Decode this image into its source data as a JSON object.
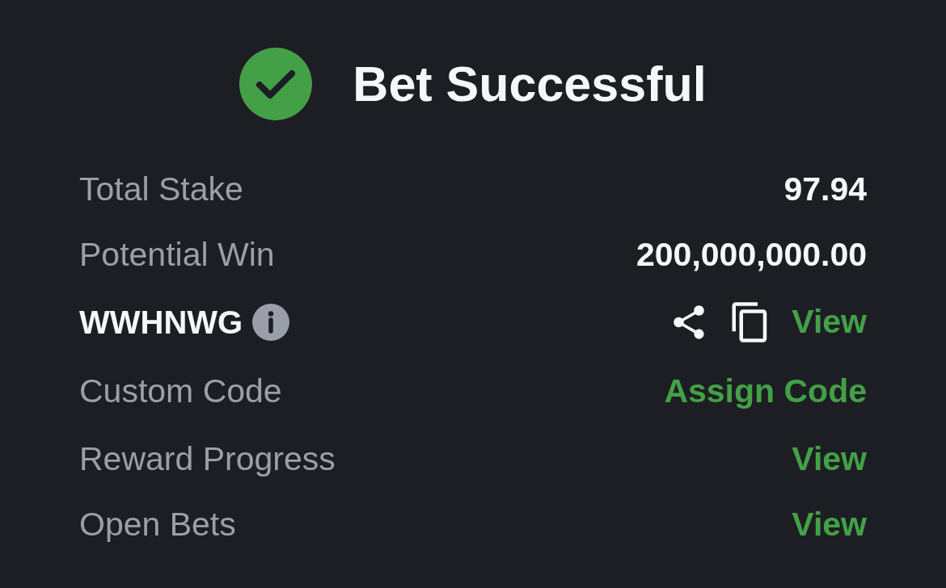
{
  "header": {
    "title": "Bet Successful"
  },
  "rows": [
    {
      "kind": "value",
      "label": "Total Stake",
      "value": "97.94"
    },
    {
      "kind": "value",
      "label": "Potential Win",
      "value": "200,000,000.00"
    },
    {
      "kind": "code",
      "label": "WWHNWG",
      "action": "View"
    },
    {
      "kind": "link",
      "label": "Custom Code",
      "action": "Assign Code"
    },
    {
      "kind": "link",
      "label": "Reward Progress",
      "action": "View"
    },
    {
      "kind": "link",
      "label": "Open Bets",
      "action": "View"
    }
  ]
}
